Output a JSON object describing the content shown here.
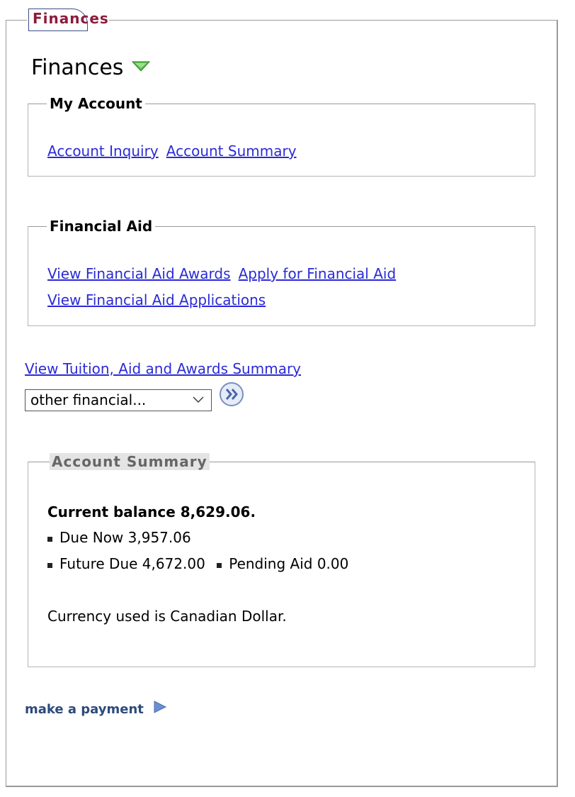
{
  "outer_tab": {
    "label": "Finances"
  },
  "page_title": "Finances",
  "my_account": {
    "legend": "My Account",
    "links": [
      "Account Inquiry",
      "Account Summary"
    ]
  },
  "financial_aid": {
    "legend": "Financial Aid",
    "links": [
      "View Financial Aid Awards",
      "Apply for Financial Aid",
      "View Financial Aid Applications"
    ]
  },
  "summary_link": "View Tuition, Aid and Awards Summary",
  "select": {
    "selected": "other financial..."
  },
  "account_summary": {
    "legend": "Account Summary",
    "current_balance": "Current balance 8,629.06.",
    "due_now": "Due Now 3,957.06",
    "future_due": "Future Due 4,672.00",
    "pending_aid": "Pending Aid 0.00",
    "currency_note": "Currency used is Canadian Dollar."
  },
  "make_payment": "make a payment",
  "colors": {
    "tab_label": "#8b1c3c",
    "link": "#2b2bd6",
    "payment_link": "#2d4a7a",
    "caret_green": "#4caf50"
  },
  "icons": [
    "triangle-down-icon",
    "chevron-down-icon",
    "double-chevron-right-icon",
    "play-arrow-icon"
  ]
}
